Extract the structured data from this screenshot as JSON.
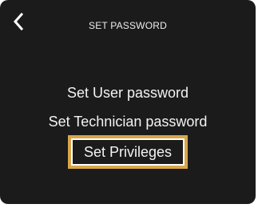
{
  "header": {
    "title": "SET PASSWORD",
    "back_icon": "chevron-left-icon"
  },
  "menu": {
    "items": [
      {
        "label": "Set User password",
        "selected": false
      },
      {
        "label": "Set Technician password",
        "selected": false
      },
      {
        "label": "Set Privileges",
        "selected": true
      }
    ]
  },
  "colors": {
    "background": "#1b1b1b",
    "text": "#f3f3f3",
    "highlight": "#d9a54a"
  }
}
